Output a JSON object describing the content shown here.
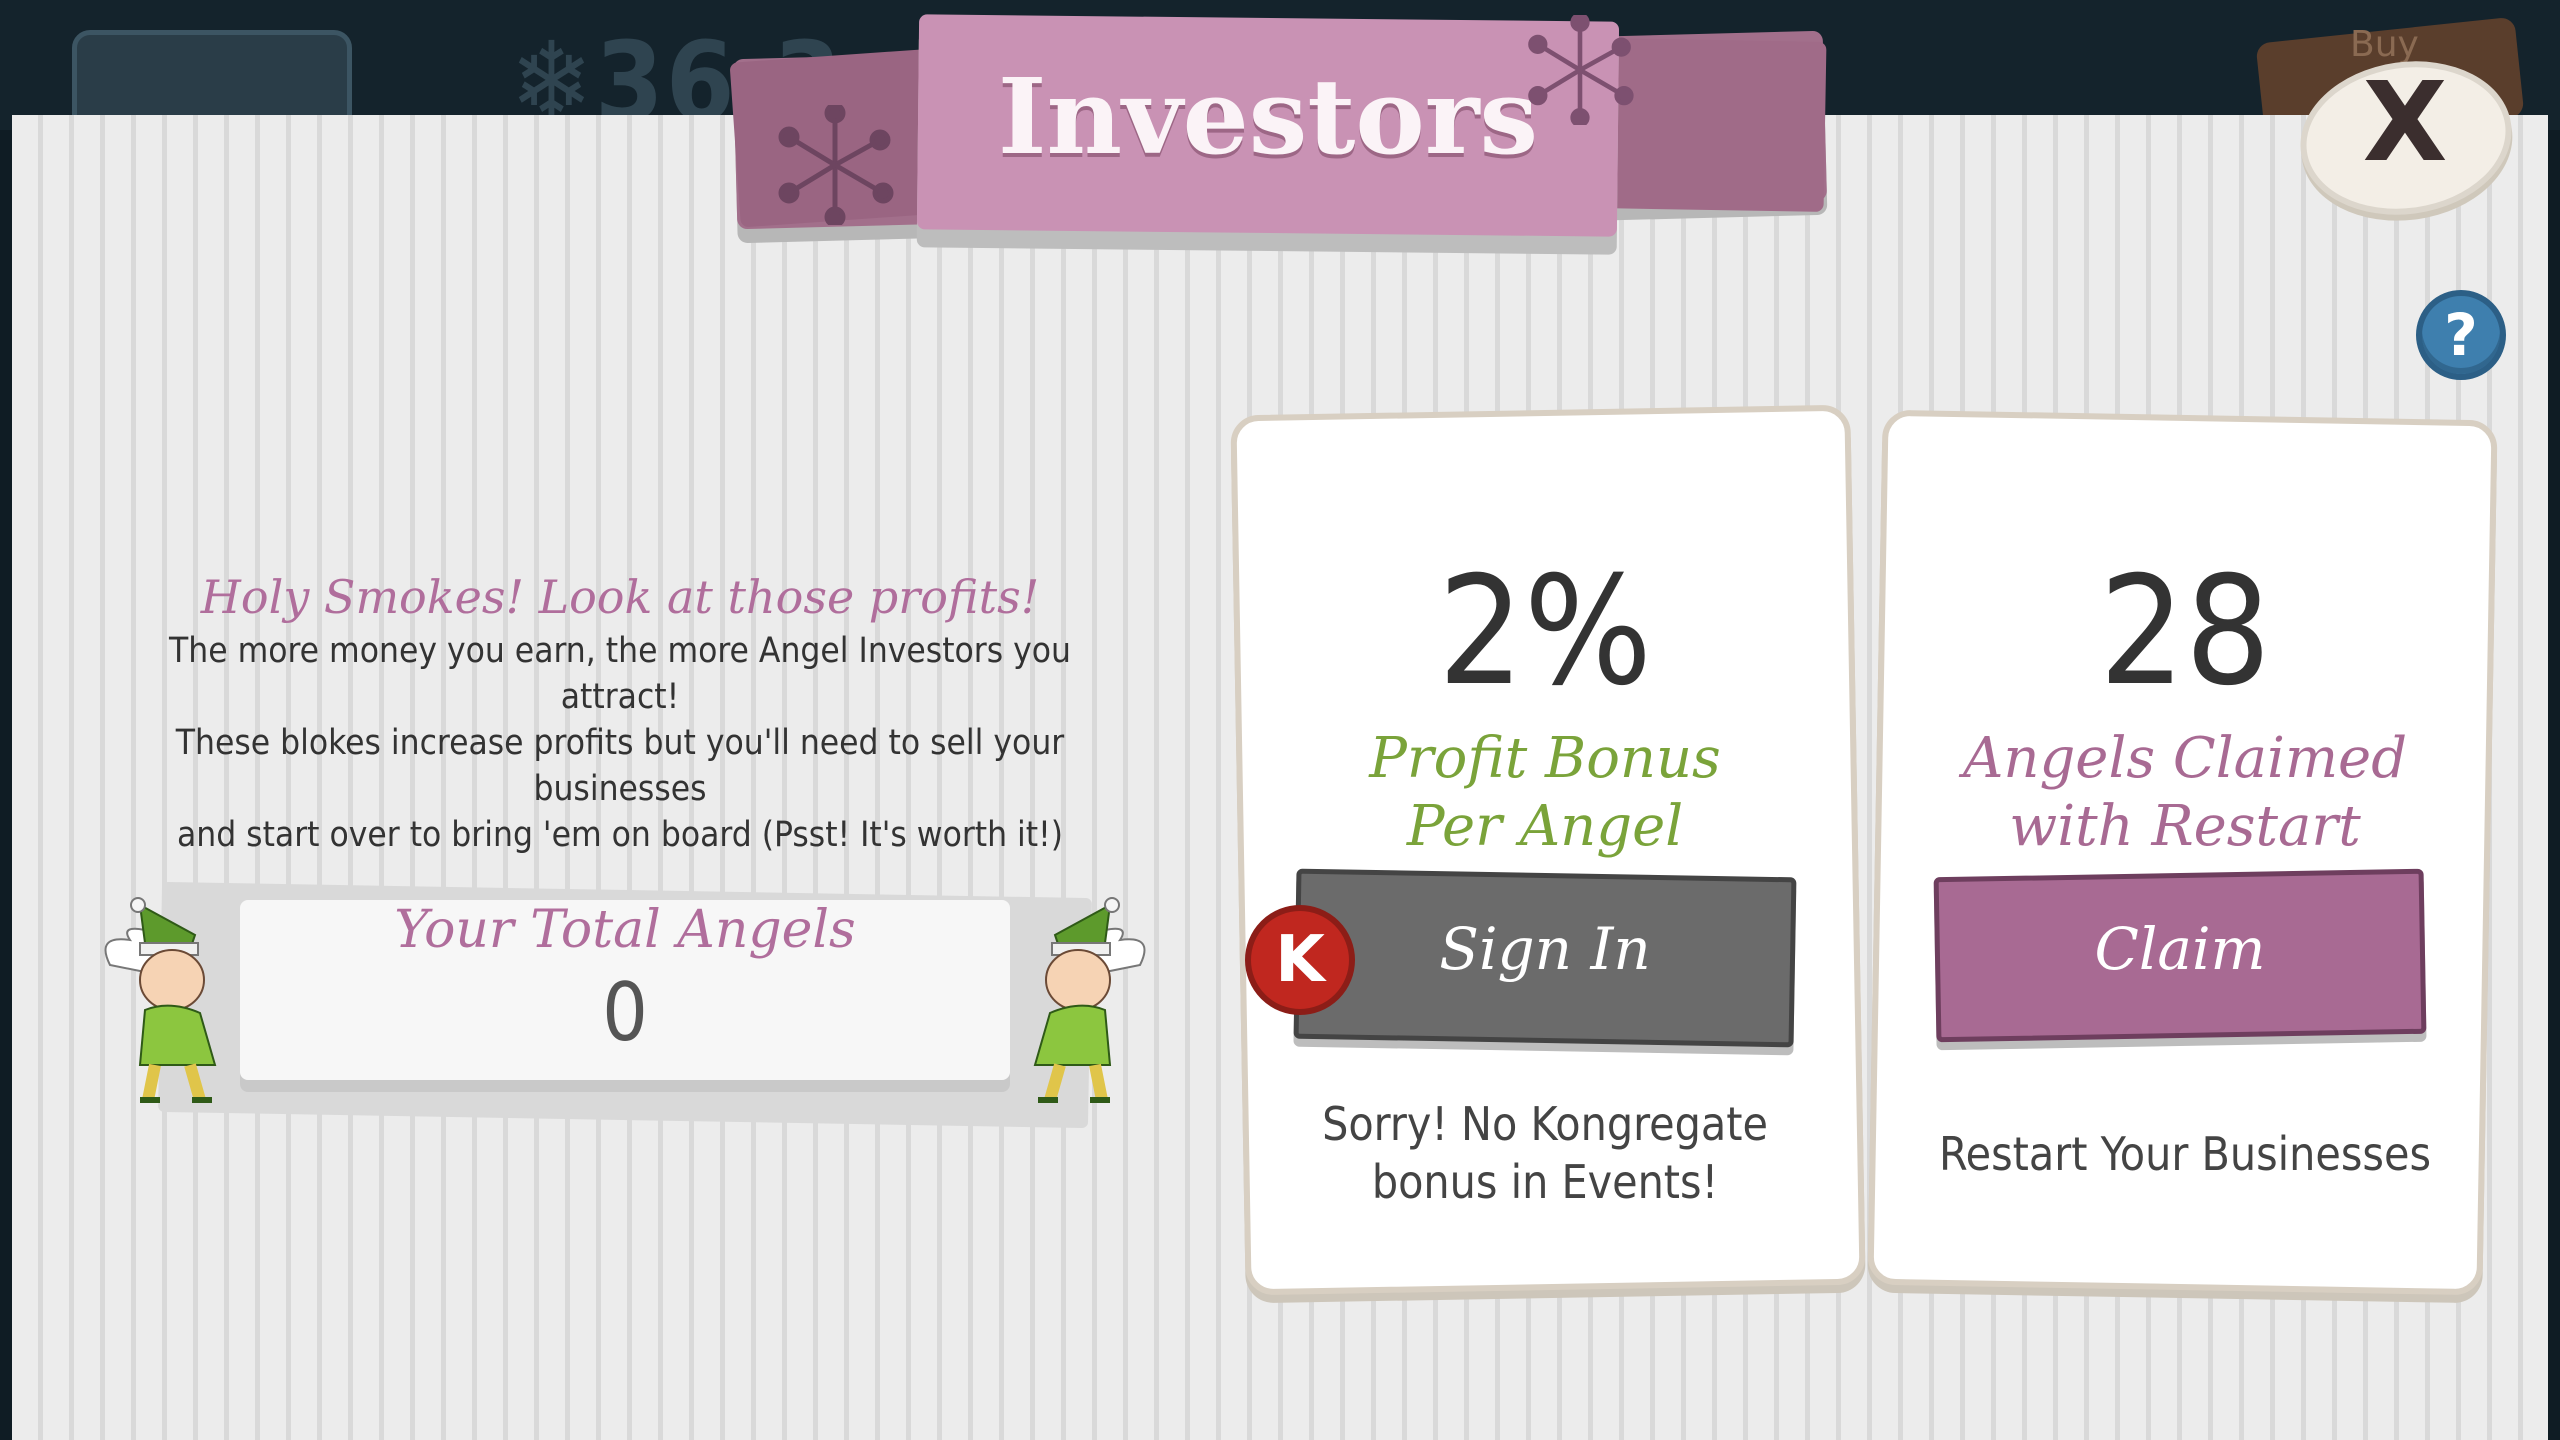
{
  "top_bar": {
    "money_text": "❄36 3",
    "buy_text": "Buy"
  },
  "modal": {
    "title": "Investors",
    "close_label": "X",
    "help_label": "?"
  },
  "info": {
    "headline": "Holy Smokes! Look at those profits!",
    "line1": "The more money you earn, the more Angel Investors you attract!",
    "line2": "These blokes increase profits but you'll need to sell your businesses",
    "line3": "and start over to bring 'em on board (Psst! It's worth it!)"
  },
  "total_angels": {
    "label": "Your Total Angels",
    "value": "0"
  },
  "profit_card": {
    "value": "2%",
    "title_line1": "Profit Bonus",
    "title_line2": "Per Angel",
    "badge_letter": "K",
    "button_label": "Sign In",
    "note_line1": "Sorry! No Kongregate",
    "note_line2": "bonus in Events!"
  },
  "claim_card": {
    "value": "28",
    "title_line1": "Angels Claimed",
    "title_line2": "with Restart",
    "button_label": "Claim",
    "note": "Restart Your Businesses"
  },
  "colors": {
    "banner": "#c992b4",
    "banner_dark": "#a26f8b",
    "profit_green": "#7aa33a",
    "claim_purple": "#a86a93",
    "sign_in_gray": "#6b6b6b",
    "kongregate_red": "#c0271f",
    "help_blue": "#3e7fae"
  },
  "icons": [
    "snowflake-icon",
    "sparkle-icon",
    "kongregate-icon",
    "close-icon",
    "help-icon",
    "elf-angel-icon"
  ]
}
